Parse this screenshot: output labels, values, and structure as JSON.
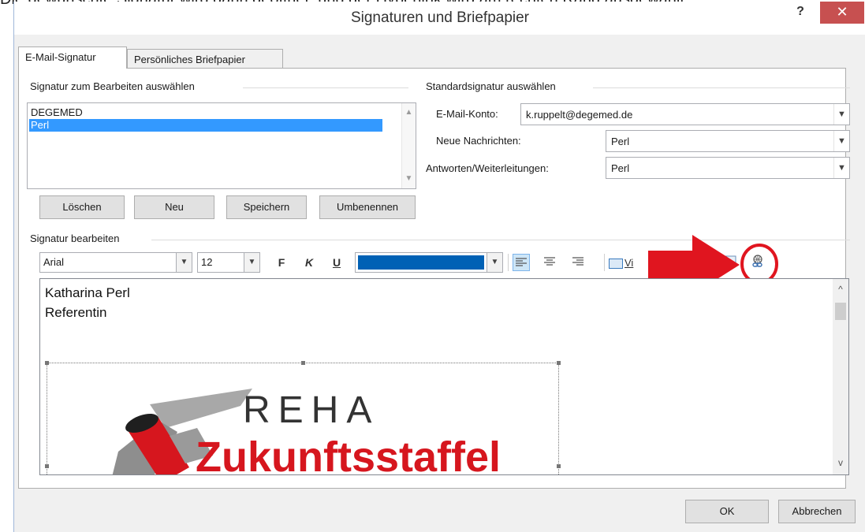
{
  "background_text": "Die gewünschte Signatur wird dann geöffnet, und der Hyperlink wird am rechten Rand ausgewählt",
  "window": {
    "title": "Signaturen und Briefpapier",
    "help_label": "?",
    "close_label": "✕"
  },
  "tabs": [
    {
      "label": "E-Mail-Signatur",
      "active": true
    },
    {
      "label": "Persönliches Briefpapier",
      "active": false
    }
  ],
  "select_signature": {
    "group_label": "Signatur zum Bearbeiten auswählen",
    "items": [
      {
        "label": "DEGEMED",
        "selected": false
      },
      {
        "label": "Perl",
        "selected": true
      }
    ]
  },
  "signature_buttons": {
    "delete": "Löschen",
    "new": "Neu",
    "save": "Speichern",
    "rename": "Umbenennen"
  },
  "default_signature": {
    "group_label": "Standardsignatur auswählen",
    "account_label": "E-Mail-Konto:",
    "account_value": "k.ruppelt@degemed.de",
    "new_messages_label": "Neue Nachrichten:",
    "new_messages_value": "Perl",
    "replies_label": "Antworten/Weiterleitungen:",
    "replies_value": "Perl"
  },
  "edit_signature": {
    "group_label": "Signatur bearbeiten",
    "font": "Arial",
    "size": "12",
    "bold_label": "F",
    "italic_label": "K",
    "underline_label": "U",
    "font_color": "#0061b5",
    "vcard_label": "Vi",
    "icons": [
      "align-left-icon",
      "align-center-icon",
      "align-right-icon",
      "business-card-icon",
      "picture-icon",
      "hyperlink-icon"
    ]
  },
  "editor": {
    "lines": [
      "Katharina Perl",
      "Referentin"
    ],
    "logo_top": "REHA",
    "logo_bottom": "Zukunftsstaffel",
    "logo_colors": {
      "grey": "#9a9a9a",
      "red": "#d6161e",
      "dark": "#333333"
    }
  },
  "annotation": {
    "arrow_color": "#e0151f"
  },
  "footer": {
    "ok": "OK",
    "cancel": "Abbrechen"
  }
}
